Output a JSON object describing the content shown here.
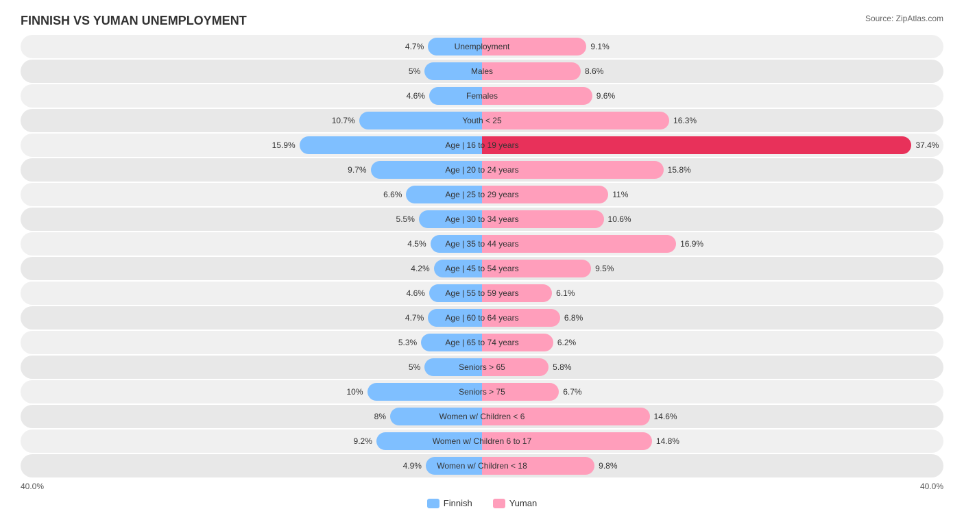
{
  "title": "FINNISH VS YUMAN UNEMPLOYMENT",
  "source": "Source: ZipAtlas.com",
  "chart": {
    "totalWidth": 100,
    "maxPct": 40,
    "rows": [
      {
        "label": "Unemployment",
        "left": 4.7,
        "right": 9.1,
        "highlight": false
      },
      {
        "label": "Males",
        "left": 5.0,
        "right": 8.6,
        "highlight": false
      },
      {
        "label": "Females",
        "left": 4.6,
        "right": 9.6,
        "highlight": false
      },
      {
        "label": "Youth < 25",
        "left": 10.7,
        "right": 16.3,
        "highlight": false
      },
      {
        "label": "Age | 16 to 19 years",
        "left": 15.9,
        "right": 37.4,
        "highlight": true
      },
      {
        "label": "Age | 20 to 24 years",
        "left": 9.7,
        "right": 15.8,
        "highlight": false
      },
      {
        "label": "Age | 25 to 29 years",
        "left": 6.6,
        "right": 11.0,
        "highlight": false
      },
      {
        "label": "Age | 30 to 34 years",
        "left": 5.5,
        "right": 10.6,
        "highlight": false
      },
      {
        "label": "Age | 35 to 44 years",
        "left": 4.5,
        "right": 16.9,
        "highlight": false
      },
      {
        "label": "Age | 45 to 54 years",
        "left": 4.2,
        "right": 9.5,
        "highlight": false
      },
      {
        "label": "Age | 55 to 59 years",
        "left": 4.6,
        "right": 6.1,
        "highlight": false
      },
      {
        "label": "Age | 60 to 64 years",
        "left": 4.7,
        "right": 6.8,
        "highlight": false
      },
      {
        "label": "Age | 65 to 74 years",
        "left": 5.3,
        "right": 6.2,
        "highlight": false
      },
      {
        "label": "Seniors > 65",
        "left": 5.0,
        "right": 5.8,
        "highlight": false
      },
      {
        "label": "Seniors > 75",
        "left": 10.0,
        "right": 6.7,
        "highlight": false
      },
      {
        "label": "Women w/ Children < 6",
        "left": 8.0,
        "right": 14.6,
        "highlight": false
      },
      {
        "label": "Women w/ Children 6 to 17",
        "left": 9.2,
        "right": 14.8,
        "highlight": false
      },
      {
        "label": "Women w/ Children < 18",
        "left": 4.9,
        "right": 9.8,
        "highlight": false
      }
    ]
  },
  "legend": {
    "items": [
      {
        "label": "Finnish",
        "color": "#7fbfff"
      },
      {
        "label": "Yuman",
        "color": "#ff9ebb"
      }
    ]
  },
  "axis": {
    "left": "40.0%",
    "right": "40.0%"
  }
}
